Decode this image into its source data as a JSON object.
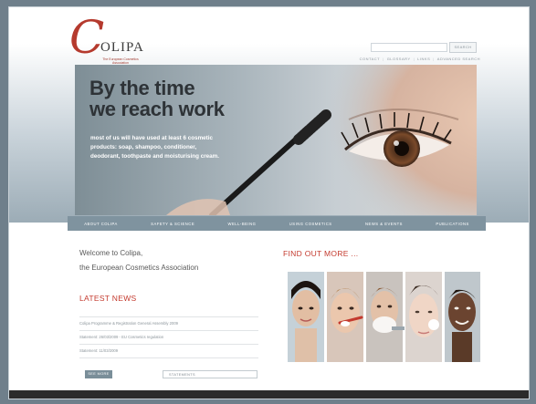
{
  "logo": {
    "letter": "C",
    "word": "OLIPA",
    "sub": "The European Cosmetics Association"
  },
  "search": {
    "placeholder": "",
    "button_label": "SEARCH"
  },
  "top_links": [
    "CONTACT",
    "GLOSSARY",
    "LINKS",
    "ADVANCED SEARCH"
  ],
  "hero": {
    "headline_line1": "By the time",
    "headline_line2": "we reach work",
    "body": "most of us will have used at least 6 cosmetic products: soap, shampoo, conditioner, deodorant, toothpaste and moisturising cream."
  },
  "nav": [
    "ABOUT COLIPA",
    "SAFETY & SCIENCE",
    "WELL-BEING",
    "USING COSMETICS",
    "NEWS & EVENTS",
    "PUBLICATIONS"
  ],
  "welcome": {
    "line1": "Welcome to Colipa,",
    "line2": "the European Cosmetics Association"
  },
  "latest_news": {
    "title": "LATEST NEWS",
    "items": [
      "Colipa Programme & Registration General Assembly 2009",
      "Statement: 26/03/2009 - EU Cosmetics regulation",
      "Statement: 11/03/2009"
    ],
    "see_more": "SEE MORE",
    "statements_select": "STATEMENTS"
  },
  "find_out_more": "FIND OUT MORE ...",
  "colors": {
    "brand_red": "#c43a2e",
    "nav_bg": "#7f939f",
    "page_bg": "#6f7f8b"
  }
}
